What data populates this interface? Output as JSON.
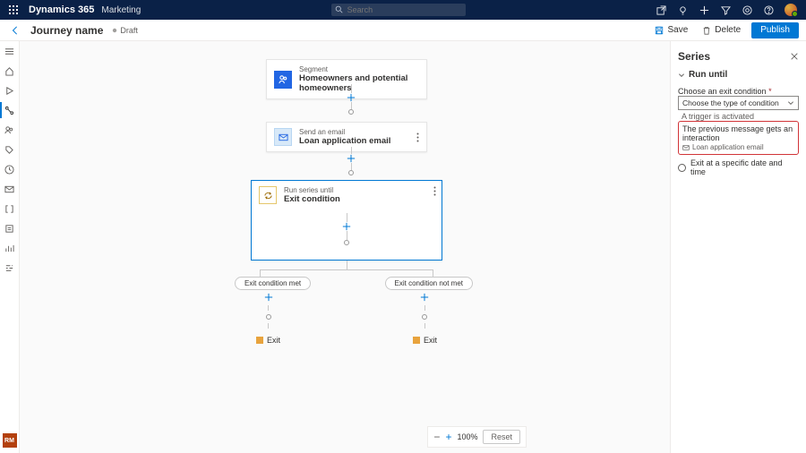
{
  "topbar": {
    "brand": "Dynamics 365",
    "module": "Marketing",
    "search_placeholder": "Search",
    "avatar_initials": "RM"
  },
  "cmdbar": {
    "title": "Journey name",
    "status": "Draft",
    "save": "Save",
    "delete": "Delete",
    "publish": "Publish"
  },
  "nodes": {
    "segment_sub": "Segment",
    "segment_main": "Homeowners and potential homeowners",
    "email_sub": "Send an email",
    "email_main": "Loan application email",
    "series_sub": "Run series until",
    "series_main": "Exit condition"
  },
  "branches": {
    "met": "Exit condition met",
    "notmet": "Exit condition not met",
    "exit": "Exit"
  },
  "zoom": {
    "pct": "100%",
    "reset": "Reset"
  },
  "panel": {
    "title": "Series",
    "section": "Run until",
    "choose_label": "Choose an exit condition",
    "choose_placeholder": "Choose the type of condition",
    "trigger_opt": "A trigger is activated",
    "redbox_title": "The previous message gets an interaction",
    "redbox_sub": "Loan application email",
    "radio_time": "Exit at a specific date and time"
  }
}
